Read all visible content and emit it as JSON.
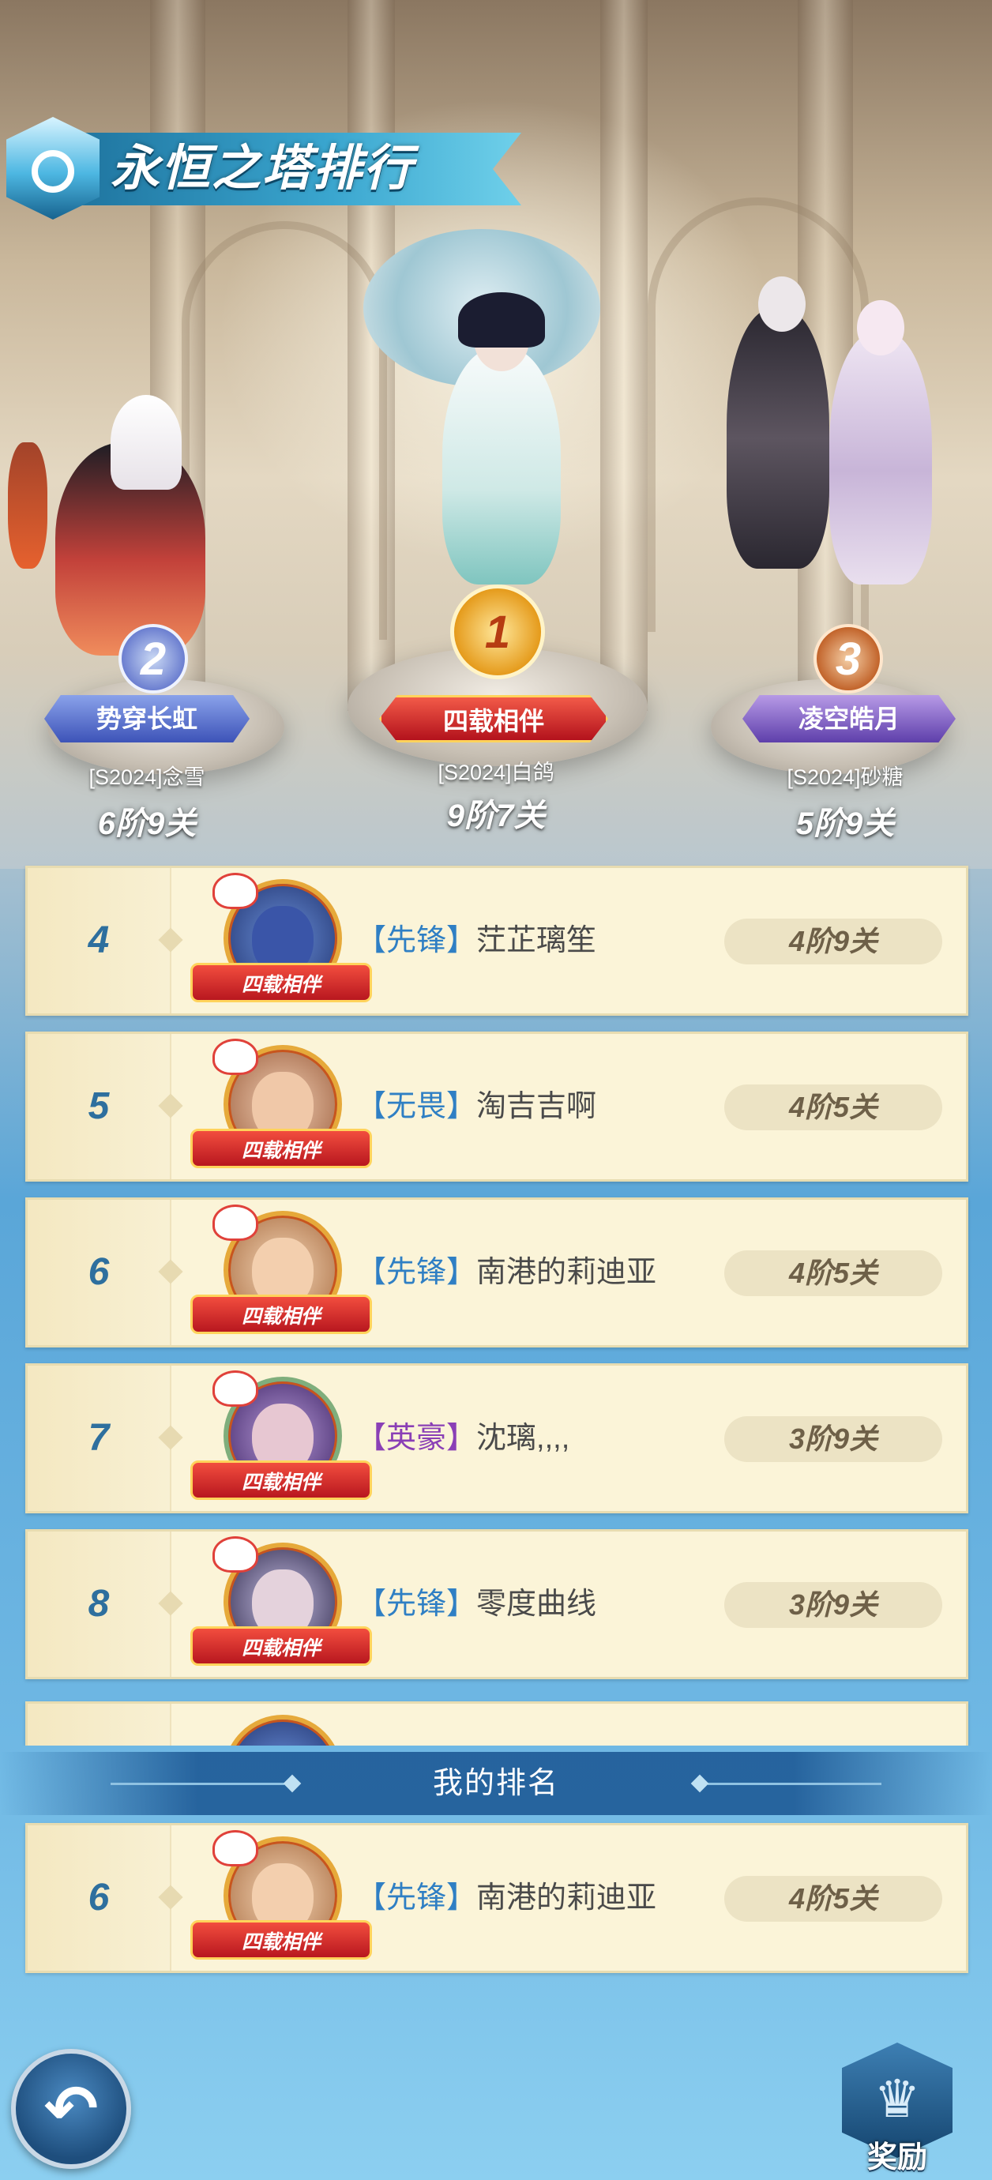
{
  "title": "永恒之塔排行",
  "podium": [
    {
      "place": "2",
      "badge": "势穿长虹",
      "player": "[S2024]念雪",
      "score": "6阶9关"
    },
    {
      "place": "1",
      "badge": "四载相伴",
      "player": "[S2024]白鸽",
      "score": "9阶7关"
    },
    {
      "place": "3",
      "badge": "凌空皓月",
      "player": "[S2024]砂糖",
      "score": "5阶9关"
    }
  ],
  "avatar_banner": "四载相伴",
  "rows": [
    {
      "rank": "4",
      "tag": "【先锋】",
      "name": "茳芷璃笙",
      "score": "4阶9关",
      "tag_color": "#2f7fc4"
    },
    {
      "rank": "5",
      "tag": "【无畏】",
      "name": "淘吉吉啊",
      "score": "4阶5关",
      "tag_color": "#2f7fc4"
    },
    {
      "rank": "6",
      "tag": "【先锋】",
      "name": "南港的莉迪亚",
      "score": "4阶5关",
      "tag_color": "#2f7fc4"
    },
    {
      "rank": "7",
      "tag": "【英豪】",
      "name": "沈璃,,,,",
      "score": "3阶9关",
      "tag_color": "#8a3fb6"
    },
    {
      "rank": "8",
      "tag": "【先锋】",
      "name": "零度曲线",
      "score": "3阶9关",
      "tag_color": "#2f7fc4"
    }
  ],
  "my_rank_label": "我的排名",
  "my_rank": {
    "rank": "6",
    "tag": "【先锋】",
    "name": "南港的莉迪亚",
    "score": "4阶5关"
  },
  "buttons": {
    "back": "↶",
    "reward": "奖励"
  },
  "colors": {
    "rank_number": "#2e6f9e",
    "row_bg": "#fbf4d8",
    "divider": "#1e5a96"
  }
}
